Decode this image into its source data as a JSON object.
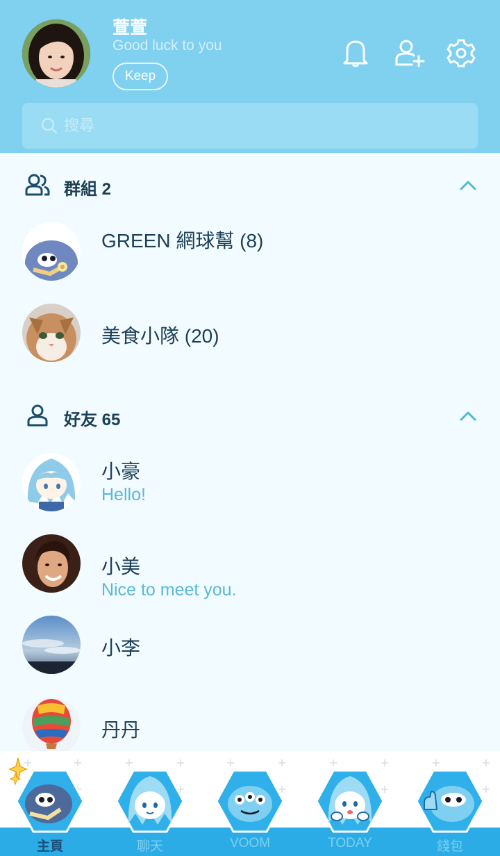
{
  "profile": {
    "name": "萱萱",
    "status": "Good luck to you",
    "keep_label": "Keep"
  },
  "header_icons": [
    "bell-icon",
    "add-friend-icon",
    "gear-icon"
  ],
  "search": {
    "placeholder": "搜尋"
  },
  "groups": {
    "title": "群組 2",
    "items": [
      {
        "name": "GREEN 網球幫 (8)"
      },
      {
        "name": "美食小隊 (20)"
      }
    ]
  },
  "friends": {
    "title": "好友 65",
    "items": [
      {
        "name": "小豪",
        "status": "Hello!"
      },
      {
        "name": "小美",
        "status": "Nice to meet you."
      },
      {
        "name": "小李",
        "status": ""
      },
      {
        "name": "丹丹",
        "status": ""
      }
    ]
  },
  "tabs": [
    {
      "label": "主頁",
      "active": true
    },
    {
      "label": "聊天",
      "active": false
    },
    {
      "label": "VOOM",
      "active": false
    },
    {
      "label": "TODAY",
      "active": false
    },
    {
      "label": "錢包",
      "active": false
    }
  ],
  "colors": {
    "header": "#80d0f0",
    "background": "#f2fbff",
    "text_dark": "#1c3f55",
    "status_text": "#5ab9d6",
    "tab_strip": "#2cace6"
  }
}
